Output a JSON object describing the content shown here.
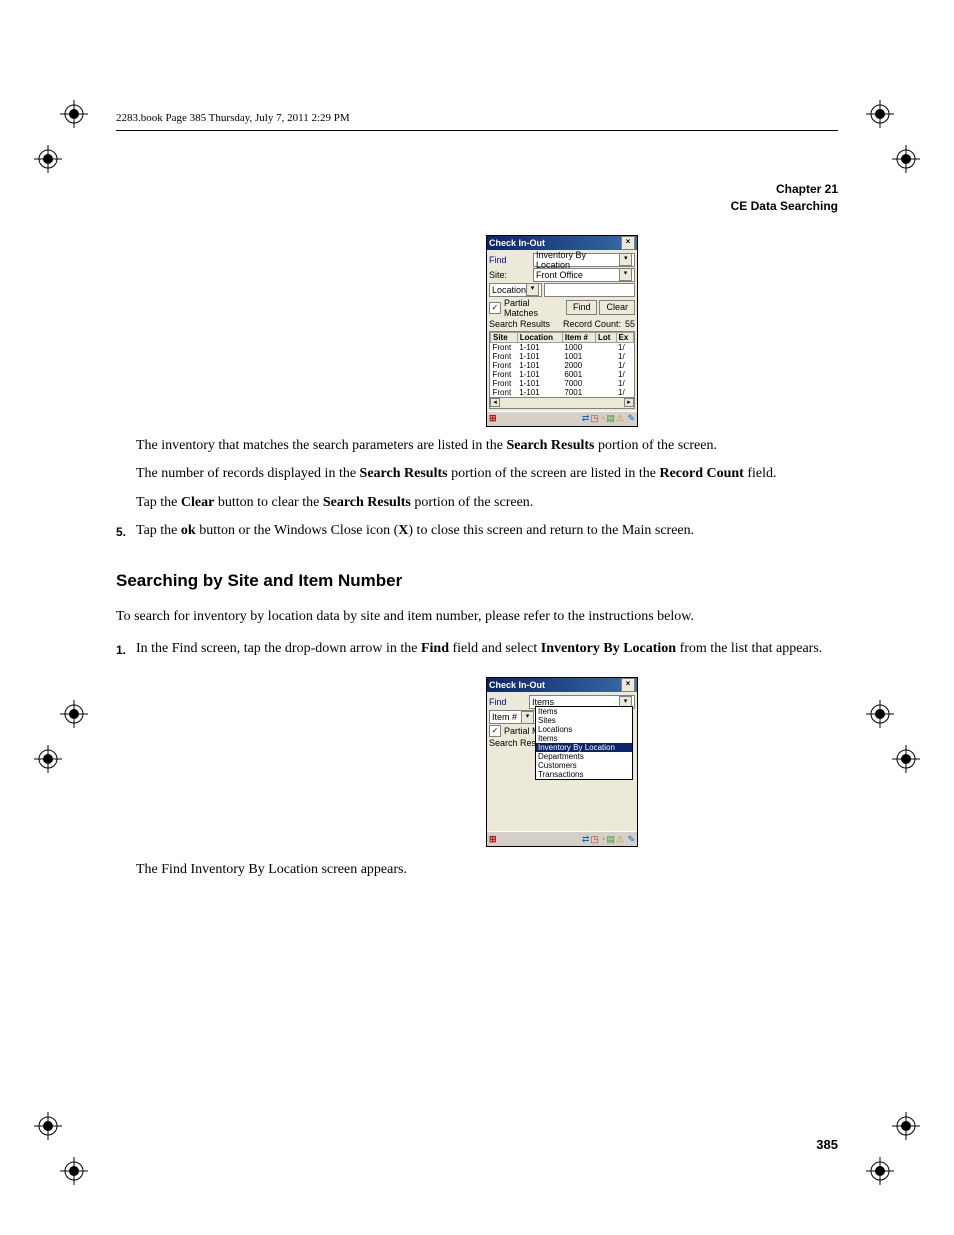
{
  "header_line": "2283.book  Page 385  Thursday, July 7, 2011  2:29 PM",
  "chapter": {
    "line1": "Chapter 21",
    "line2": "CE Data Searching"
  },
  "screenshot1": {
    "title": "Check In-Out",
    "find_label": "Find",
    "find_value": "Inventory By Location",
    "site_label": "Site:",
    "site_value": "Front Office",
    "loc_label": "Location",
    "partial_label": "Partial Matches",
    "find_btn": "Find",
    "clear_btn": "Clear",
    "results_label": "Search Results",
    "record_count_label": "Record Count:",
    "record_count_value": "55",
    "headers": [
      "Site",
      "Location",
      "Item #",
      "Lot",
      "Ex"
    ],
    "rows": [
      [
        "Front",
        "1-101",
        "1000",
        "",
        "1/"
      ],
      [
        "Front",
        "1-101",
        "1001",
        "",
        "1/"
      ],
      [
        "Front",
        "1-101",
        "2000",
        "",
        "1/"
      ],
      [
        "Front",
        "1-101",
        "6001",
        "",
        "1/"
      ],
      [
        "Front",
        "1-101",
        "7000",
        "",
        "1/"
      ],
      [
        "Front",
        "1-101",
        "7001",
        "",
        "1/"
      ]
    ],
    "chart_data": {
      "type": "table",
      "columns": [
        "Site",
        "Location",
        "Item #",
        "Lot",
        "Ex"
      ],
      "rows": [
        [
          "Front",
          "1-101",
          "1000",
          "",
          "1/"
        ],
        [
          "Front",
          "1-101",
          "1001",
          "",
          "1/"
        ],
        [
          "Front",
          "1-101",
          "2000",
          "",
          "1/"
        ],
        [
          "Front",
          "1-101",
          "6001",
          "",
          "1/"
        ],
        [
          "Front",
          "1-101",
          "7000",
          "",
          "1/"
        ],
        [
          "Front",
          "1-101",
          "7001",
          "",
          "1/"
        ]
      ]
    }
  },
  "body": {
    "p1a": "The inventory that matches the search parameters are listed in the ",
    "p1b": "Search Results",
    "p1c": " portion of the screen.",
    "p2a": "The number of records displayed in the ",
    "p2b": "Search Results",
    "p2c": " portion of the screen are listed in the ",
    "p2d": "Record Count",
    "p2e": " field.",
    "p3a": "Tap the ",
    "p3b": "Clear",
    "p3c": " button to clear the ",
    "p3d": "Search Results",
    "p3e": " portion of the screen.",
    "step5_num": "5.",
    "step5a": "Tap the ",
    "step5b": "ok",
    "step5c": " button or the Windows Close icon (",
    "step5d": "X",
    "step5e": ") to close this screen and return to the Main screen."
  },
  "section_title": "Searching by Site and Item Number",
  "intro2": "To search for inventory by location data by site and item number, please refer to the instructions below.",
  "step1_num": "1.",
  "step1a": "In the Find screen, tap the drop-down arrow in the ",
  "step1b": "Find",
  "step1c": " field and select ",
  "step1d": "Inventory By Location",
  "step1e": " from the list that appears.",
  "screenshot2": {
    "title": "Check In-Out",
    "find_label": "Find",
    "find_value": "Items",
    "item_label": "Item #",
    "partial_label": "Partial Matc",
    "results_label": "Search Results",
    "options": [
      "Items",
      "Sites",
      "Locations",
      "Items",
      "Inventory By Location",
      "Departments",
      "Customers",
      "Transactions"
    ],
    "selected_index": 4
  },
  "closing": "The Find Inventory By Location screen appears.",
  "page_number": "385"
}
